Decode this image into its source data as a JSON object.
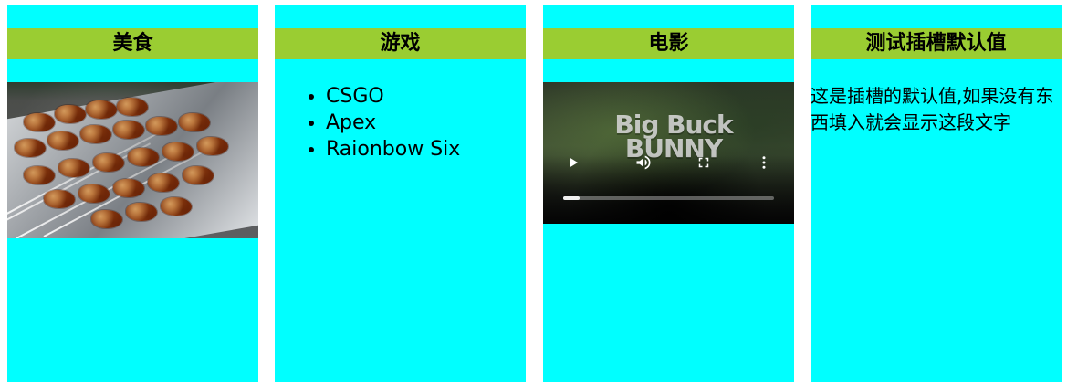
{
  "cards": [
    {
      "title": "美食"
    },
    {
      "title": "游戏",
      "items": [
        "CSGO",
        "Apex",
        "Raionbow Six"
      ]
    },
    {
      "title": "电影",
      "video": {
        "logo_line1": "Big Buck",
        "logo_line2": "BUNNY",
        "progress": 0.08
      }
    },
    {
      "title": "测试插槽默认值",
      "default_text": "这是插槽的默认值,如果没有东西填入就会显示这段文字"
    }
  ],
  "icons": {
    "play": "play-icon",
    "volume": "volume-icon",
    "fullscreen": "fullscreen-icon",
    "more": "more-vert-icon"
  },
  "colors": {
    "card_bg": "#00ffff",
    "title_bar": "#9acd32"
  }
}
